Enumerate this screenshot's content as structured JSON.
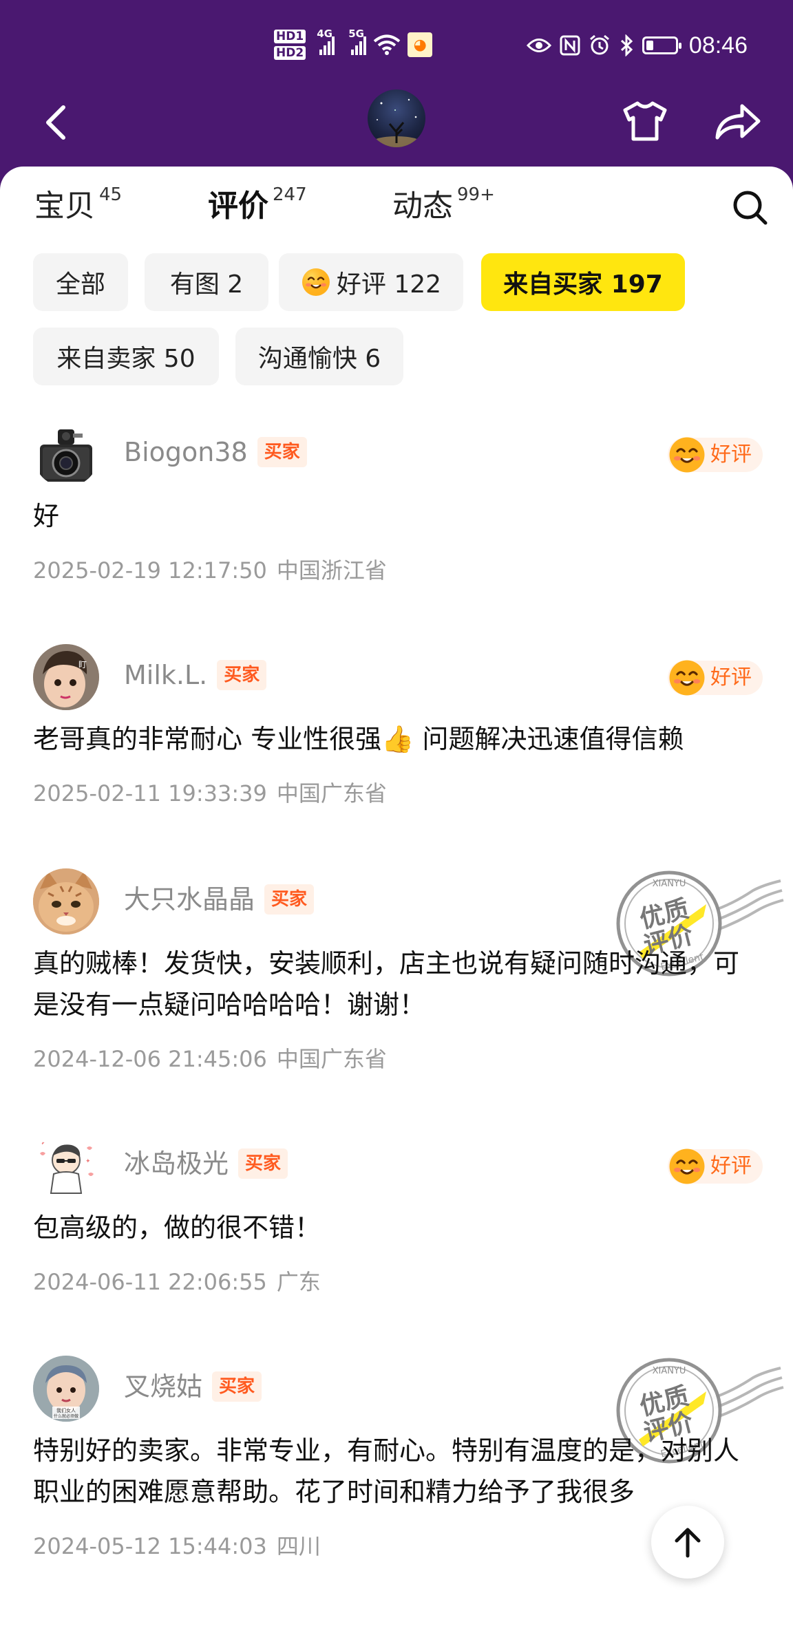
{
  "status_bar": {
    "sim1": "HD",
    "sim1_num": "1",
    "sim2": "HD",
    "sim2_num": "2",
    "net1": "4G",
    "net2": "5G",
    "time": "08:46",
    "battery_level": 0.25,
    "icons": [
      "signal-icon",
      "wifi-icon",
      "app-notification-icon",
      "eye-icon",
      "nfc-icon",
      "alarm-icon",
      "bluetooth-icon",
      "battery-icon"
    ]
  },
  "header": {
    "icons": [
      "back-arrow-icon",
      "shirt-icon",
      "share-icon"
    ]
  },
  "tabs": [
    {
      "label": "宝贝",
      "count": "45",
      "active": false
    },
    {
      "label": "评价",
      "count": "247",
      "active": true
    },
    {
      "label": "动态",
      "count": "99+",
      "active": false
    }
  ],
  "filters": [
    {
      "label": "全部",
      "active": false
    },
    {
      "label": "有图 2",
      "active": false
    },
    {
      "label": "好评 122",
      "active": false,
      "icon": "smile-face-icon"
    },
    {
      "label": "来自买家 197",
      "active": true
    },
    {
      "label": "来自卖家 50",
      "active": false
    },
    {
      "label": "沟通愉快 6",
      "active": false
    }
  ],
  "reviews": [
    {
      "user": "Biogon38",
      "role": "买家",
      "rating": "好评",
      "text": "好",
      "date": "2025-02-19 12:17:50",
      "location": "中国浙江省",
      "avatar": "camera-avatar"
    },
    {
      "user": "Milk.L.",
      "role": "买家",
      "rating": "好评",
      "text": "老哥真的非常耐心 专业性很强👍 问题解决迅速值得信赖",
      "date": "2025-02-11 19:33:39",
      "location": "中国广东省",
      "avatar": "baby-avatar"
    },
    {
      "user": "大只水晶晶",
      "role": "买家",
      "text": "真的贼棒！发货快，安装顺利，店主也说有疑问随时沟通，可是没有一点疑问哈哈哈哈！谢谢！",
      "date": "2024-12-06 21:45:06",
      "location": "中国广东省",
      "avatar": "cat-avatar",
      "stamp": {
        "brand": "XIANYU",
        "line1": "优质",
        "line2": "评价",
        "sub": "Excellent"
      }
    },
    {
      "user": "冰岛极光",
      "role": "买家",
      "rating": "好评",
      "text": "包高级的，做的很不错！",
      "date": "2024-06-11 22:06:55",
      "location": "广东",
      "avatar": "cartoon-avatar"
    },
    {
      "user": "叉烧姑",
      "role": "买家",
      "text": "特别好的卖家。非常专业，有耐心。特别有温度的是，对别人职业的困难愿意帮助。花了时间和精力给予了我很多",
      "date": "2024-05-12 15:44:03",
      "location": "四川",
      "avatar": "child-avatar",
      "stamp": {
        "brand": "XIANYU",
        "line1": "优质",
        "line2": "评价",
        "sub": "Excellent"
      }
    }
  ],
  "colors": {
    "header_bg": "#4a1870",
    "accent_yellow": "#ffe60f",
    "badge_orange": "#ff5a1f"
  }
}
